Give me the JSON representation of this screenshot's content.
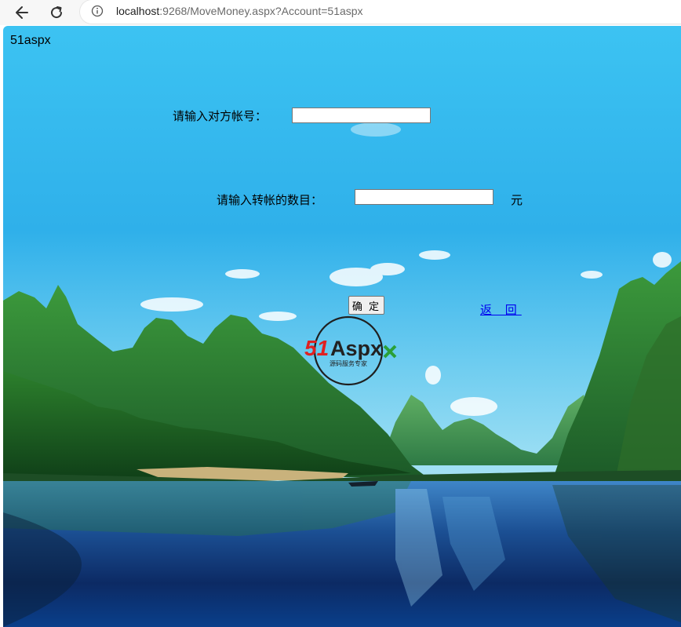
{
  "browser": {
    "url_host": "localhost",
    "url_rest": ":9268/MoveMoney.aspx?Account=51aspx"
  },
  "page": {
    "account_label": "51aspx",
    "target_account_label": "请输入对方帐号：",
    "target_account_value": "",
    "amount_label": "请输入转帐的数目：",
    "amount_value": "",
    "amount_unit": "元",
    "confirm_label": "确 定",
    "back_label": "返 回"
  },
  "logo": {
    "text_51": "51",
    "text_aspx": "Aspx",
    "tagline": "源码服务专家",
    "colors": {
      "red": "#e02020",
      "green": "#2aa038",
      "dark": "#222222"
    }
  },
  "icons": {
    "back": "back-arrow-icon",
    "reload": "reload-icon",
    "info": "info-icon"
  },
  "colors": {
    "link": "#0000ee",
    "sky_top": "#3ec6f3",
    "water": "#0d2f66"
  }
}
